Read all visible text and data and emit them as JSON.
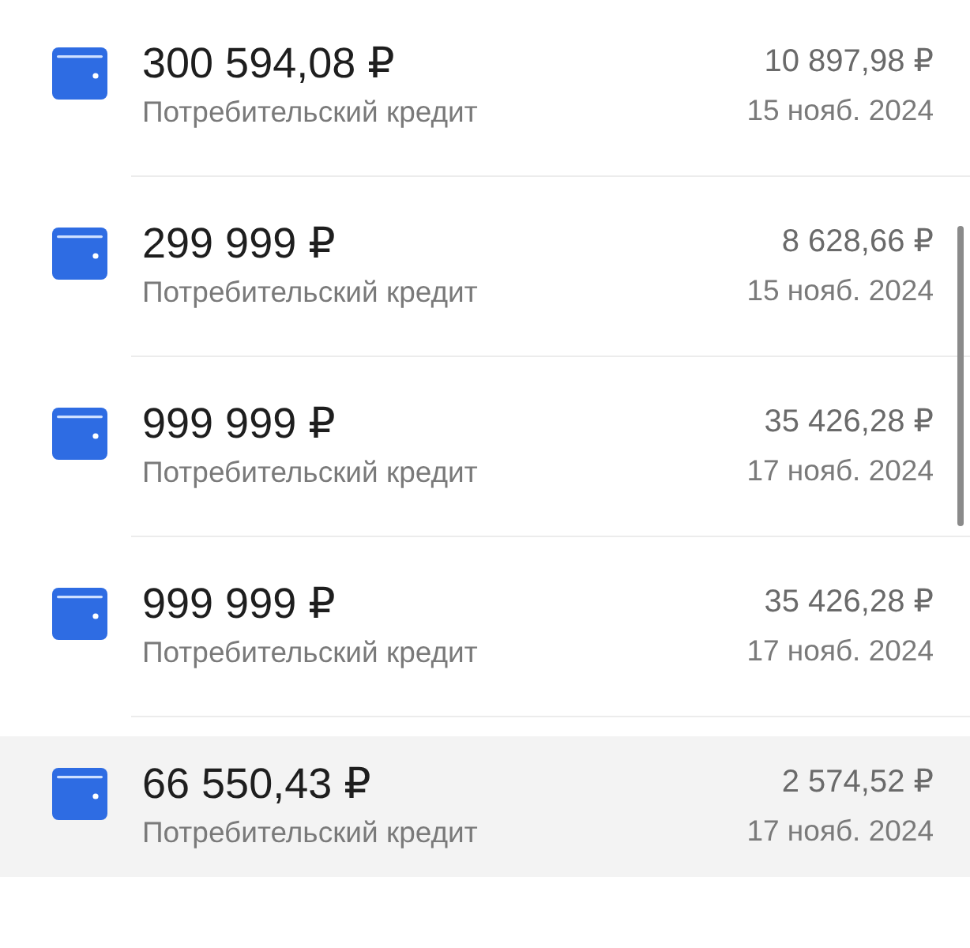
{
  "loans": [
    {
      "amount": "300 594,08 ₽",
      "type": "Потребительский кредит",
      "payment": "10 897,98 ₽",
      "date": "15 нояб. 2024",
      "selected": false
    },
    {
      "amount": "299 999 ₽",
      "type": "Потребительский кредит",
      "payment": "8 628,66 ₽",
      "date": "15 нояб. 2024",
      "selected": false
    },
    {
      "amount": "999 999 ₽",
      "type": "Потребительский кредит",
      "payment": "35 426,28 ₽",
      "date": "17 нояб. 2024",
      "selected": false
    },
    {
      "amount": "999 999 ₽",
      "type": "Потребительский кредит",
      "payment": "35 426,28 ₽",
      "date": "17 нояб. 2024",
      "selected": false
    },
    {
      "amount": "66 550,43 ₽",
      "type": "Потребительский кредит",
      "payment": "2 574,52 ₽",
      "date": "17 нояб. 2024",
      "selected": true
    }
  ]
}
